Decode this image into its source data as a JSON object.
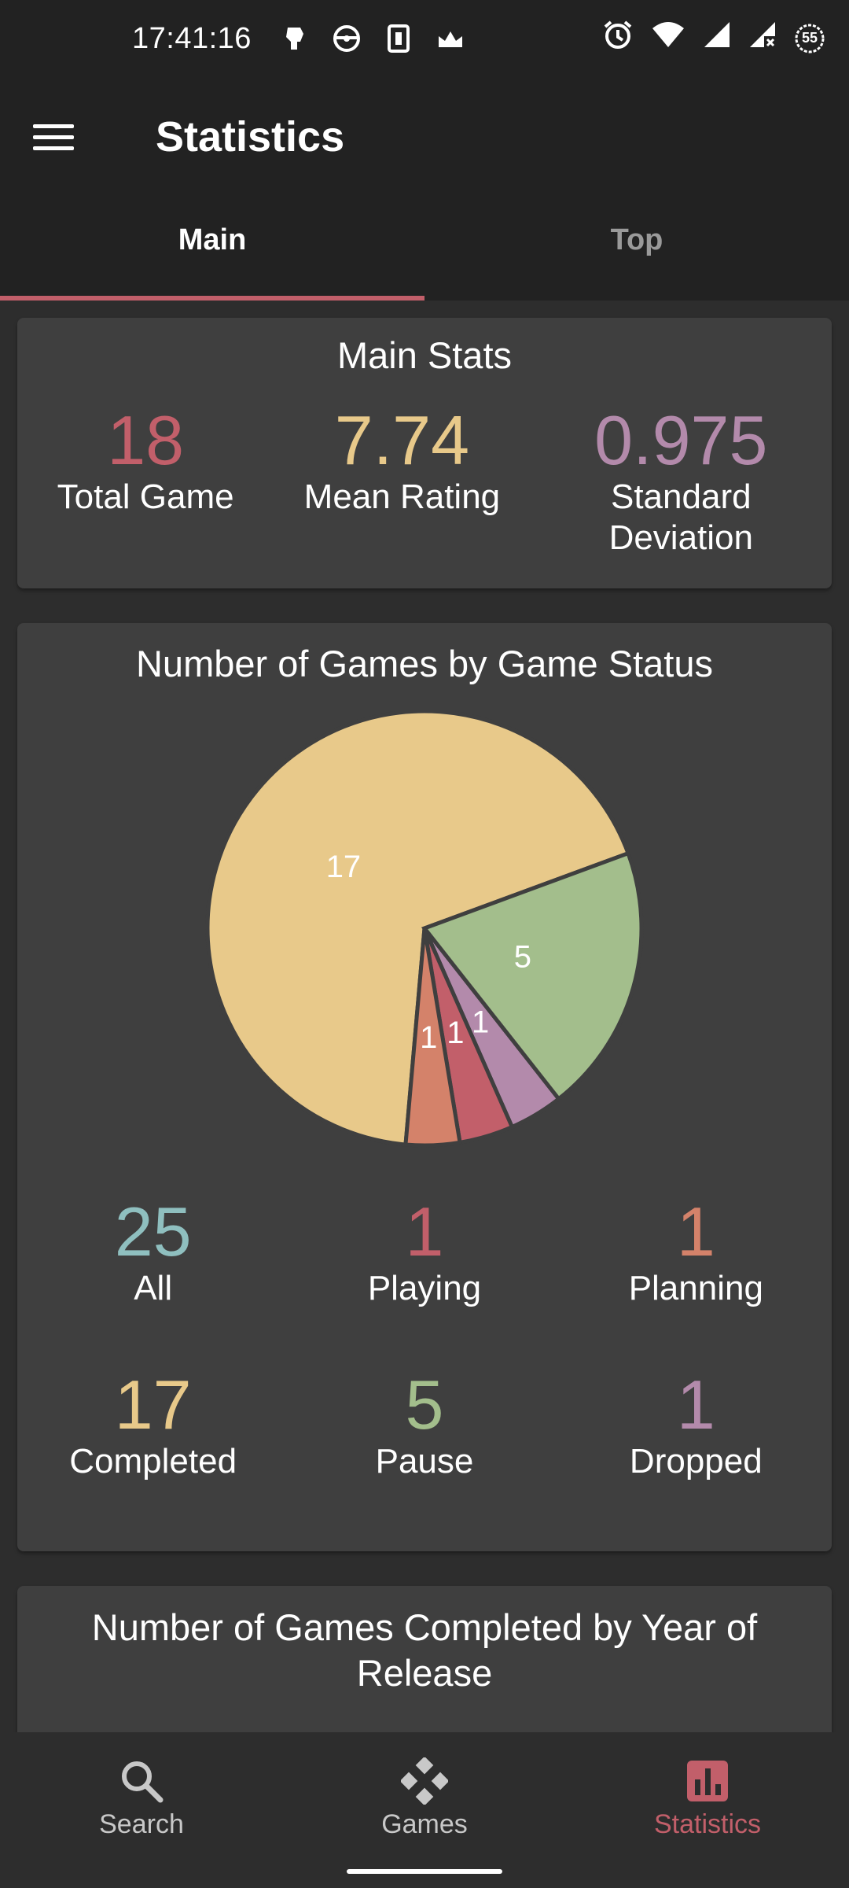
{
  "status_bar": {
    "time": "17:41:16",
    "battery": "55"
  },
  "app_bar": {
    "title": "Statistics"
  },
  "tabs": [
    {
      "label": "Main",
      "active": true
    },
    {
      "label": "Top",
      "active": false
    }
  ],
  "main_stats": {
    "title": "Main Stats",
    "items": [
      {
        "value": "18",
        "label": "Total Game",
        "color": "#c25f6a"
      },
      {
        "value": "7.74",
        "label": "Mean Rating",
        "color": "#e8c98a"
      },
      {
        "value": "0.975",
        "label": "Standard Deviation",
        "color": "#b38aab"
      }
    ]
  },
  "game_status": {
    "title": "Number of Games by Game Status",
    "counts": [
      {
        "value": "25",
        "label": "All",
        "color": "#8fbfbf"
      },
      {
        "value": "1",
        "label": "Playing",
        "color": "#c25f6a"
      },
      {
        "value": "1",
        "label": "Planning",
        "color": "#d4826a"
      },
      {
        "value": "17",
        "label": "Completed",
        "color": "#e8c98a"
      },
      {
        "value": "5",
        "label": "Pause",
        "color": "#a3be8c"
      },
      {
        "value": "1",
        "label": "Dropped",
        "color": "#b38aab"
      }
    ]
  },
  "chart_data": {
    "type": "pie",
    "slices": [
      {
        "label": "Completed",
        "value": 17,
        "color": "#e8c98a"
      },
      {
        "label": "Pause",
        "value": 5,
        "color": "#a3be8c"
      },
      {
        "label": "Dropped",
        "value": 1,
        "color": "#b38aab"
      },
      {
        "label": "Playing",
        "value": 1,
        "color": "#c25f6a"
      },
      {
        "label": "Planning",
        "value": 1,
        "color": "#d4826a"
      }
    ],
    "data_labels": [
      "17",
      "5",
      "1",
      "1",
      "1"
    ],
    "title": ""
  },
  "completed_by_year": {
    "title": "Number of Games Completed by Year of Release"
  },
  "bottom_nav": [
    {
      "label": "Search",
      "icon": "search-icon",
      "active": false
    },
    {
      "label": "Games",
      "icon": "gamepad-icon",
      "active": false
    },
    {
      "label": "Statistics",
      "icon": "bar-chart-icon",
      "active": true
    }
  ]
}
